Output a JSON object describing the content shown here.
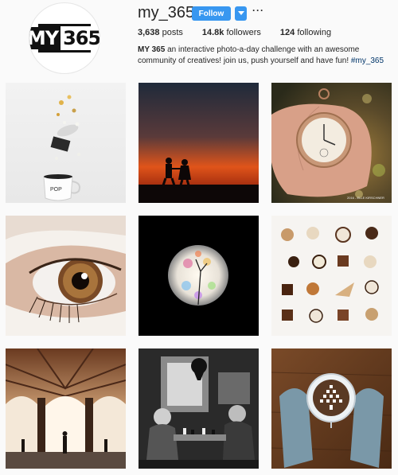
{
  "profile": {
    "logo_text_a": "MY",
    "logo_text_b": "365",
    "username": "my_365",
    "follow_label": "Follow",
    "more_label": "···",
    "stats": {
      "posts_count": "3,638",
      "posts_label": "posts",
      "followers_count": "14.8k",
      "followers_label": "followers",
      "following_count": "124",
      "following_label": "following"
    },
    "bio": {
      "name": "MY 365",
      "text": " an interactive photo-a-day challenge with an awesome community of creatives! join us, push yourself and have fun! ",
      "hashtag": "#my_365"
    }
  },
  "photos": [
    {
      "name": "popcorn-cup-photo",
      "label": "POP"
    },
    {
      "name": "sunset-couple-photo"
    },
    {
      "name": "pocket-watch-photo",
      "label": "2016 - ELLE KIRSCHNER"
    },
    {
      "name": "eye-closeup-photo"
    },
    {
      "name": "bokeh-circle-photo"
    },
    {
      "name": "chocolates-photo"
    },
    {
      "name": "arched-hall-photo"
    },
    {
      "name": "chess-players-photo"
    },
    {
      "name": "marshmallow-mug-photo"
    }
  ],
  "colors": {
    "accent": "#3897f0",
    "background": "#fafafa",
    "text": "#262626",
    "hashtag": "#003569"
  }
}
